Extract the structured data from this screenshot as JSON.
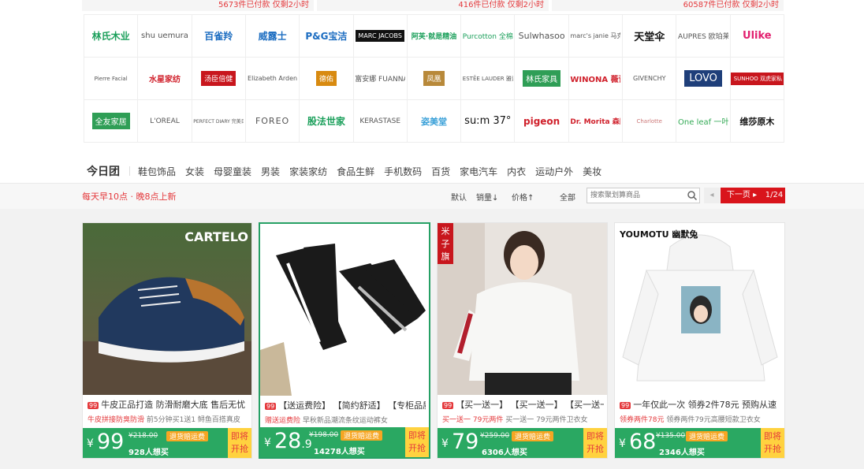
{
  "sold_strip": [
    {
      "count": "5673件已付款",
      "remain": "仅剩2小时"
    },
    {
      "count": "416件已付款",
      "remain": "仅剩2小时"
    },
    {
      "count": "60587件已付款",
      "remain": "仅剩2小时"
    }
  ],
  "brands": [
    [
      "林氏木业",
      "shu uemura",
      "百雀羚",
      "威露士",
      "P&G宝洁",
      "MARC JACOBS",
      "阿芙·就是精油",
      "Purcotton 全棉时代",
      "Sulwhasoo",
      "marc's janie 马克珍妮",
      "天堂伞",
      "AUPRES 欧珀莱",
      "Ulike"
    ],
    [
      "Pierre Facial",
      "水星家纺",
      "汤臣倍健",
      "Elizabeth Arden",
      "德佑",
      "富安娜 FUANNA",
      "凤凰",
      "ESTĒE LAUDER 雅诗兰黛",
      "林氏家具",
      "WINONA 薇诺娜",
      "GIVENCHY",
      "LOVO",
      "SUNHOO 双虎家私"
    ],
    [
      "全友家居",
      "L'ORÉAL",
      "PERFECT DIARY 完美日记",
      "FOREO",
      "股法世家",
      "KÉRASTASE",
      "姿美堂",
      "su:m 37°",
      "pigeon",
      "Dr. Morita 森田",
      "Charlotte",
      "One leaf 一叶子",
      "维莎原木"
    ]
  ],
  "category_nav": {
    "title": "今日团",
    "items": [
      "鞋包饰品",
      "女装",
      "母婴童装",
      "男装",
      "家装家纺",
      "食品生鲜",
      "手机数码",
      "百货",
      "家电汽车",
      "内衣",
      "运动户外",
      "美妆"
    ]
  },
  "toolbar": {
    "notice": "每天早10点 · 晚8点上新",
    "sort_default": "默认",
    "sort_sales": "销量↓",
    "sort_price": "价格↑",
    "filter_all": "全部",
    "search_placeholder": "搜索聚划算商品",
    "next_label": "下一页 ▸",
    "prev_label": "◂",
    "page": "1/24"
  },
  "products": [
    {
      "title": "牛皮正品打造 防滑耐磨大底 售后无忧",
      "tag": "99",
      "promo_hl": "牛皮拼接防臭防滑",
      "promo": "前5分钟买1送1 鲟鱼百搭真皮",
      "price": "99",
      "price_decimal": "",
      "orig": "¥218.00",
      "badge": "退货赔运费",
      "buyers": "928人想买",
      "soon": [
        "即将",
        "开抢"
      ],
      "brand": "CARTELO"
    },
    {
      "title": "【送运费险】 【简约舒适】 【专柜品质】",
      "tag": "99",
      "promo_hl": "赠送运费险",
      "promo": "早秋新品潮流条纹运动裤女",
      "price": "28",
      "price_decimal": ".9",
      "orig": "¥198.00",
      "badge": "退货赔运费",
      "buyers": "14278人想买",
      "soon": [
        "即将",
        "开抢"
      ],
      "brand": ""
    },
    {
      "title": "【买一送一】 【买一送一】 【买一送一】",
      "tag": "99",
      "promo_hl": "买一送一 79元两件",
      "promo": "买一送一 79元两件卫衣女",
      "price": "79",
      "price_decimal": "",
      "orig": "¥259.00",
      "badge": "退货赔运费",
      "buyers": "6306人想买",
      "soon": [
        "即将",
        "开抢"
      ],
      "brand": "米子旗"
    },
    {
      "title": "一年仅此一次 领券2件78元 预购从速",
      "tag": "99",
      "promo_hl": "领券两件78元",
      "promo": "领券两件79元高腰短款卫衣女",
      "price": "68",
      "price_decimal": "",
      "orig": "¥135.00",
      "badge": "退货赔运费",
      "buyers": "2346人想买",
      "soon": [
        "即将",
        "开抢"
      ],
      "brand": "YOUMOTU 幽默兔"
    }
  ]
}
